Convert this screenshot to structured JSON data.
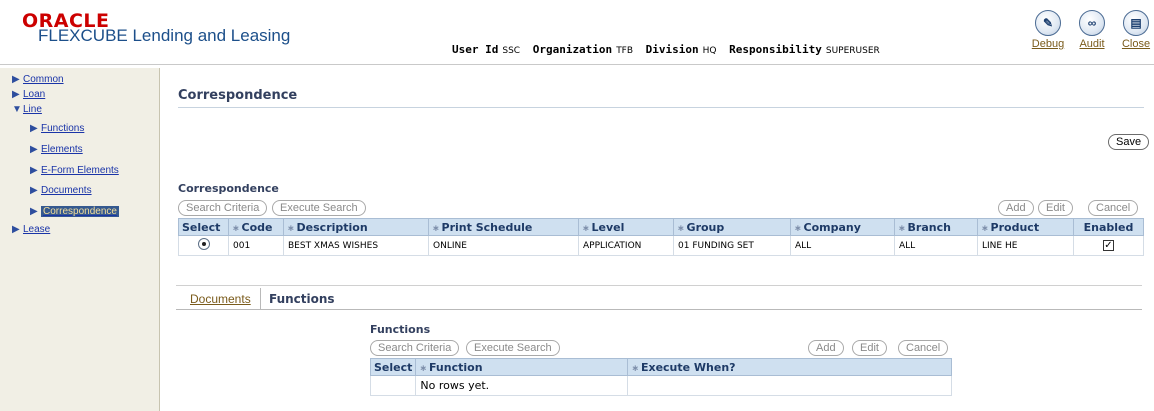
{
  "header": {
    "brand": "ORACLE",
    "app_name": "FLEXCUBE Lending and Leasing",
    "user_fields": [
      {
        "label": "User Id",
        "value": "SSC"
      },
      {
        "label": "Organization",
        "value": "TFB"
      },
      {
        "label": "Division",
        "value": "HQ"
      },
      {
        "label": "Responsibility",
        "value": "SUPERUSER"
      }
    ],
    "global_buttons": [
      {
        "label": "Debug",
        "icon": "debug-icon",
        "glyph": "✎"
      },
      {
        "label": "Audit",
        "icon": "audit-icon",
        "glyph": "∞"
      },
      {
        "label": "Close",
        "icon": "close-icon",
        "glyph": "▤"
      }
    ]
  },
  "sidebar": {
    "items": [
      {
        "label": "Common",
        "expanded": false,
        "level": 0
      },
      {
        "label": "Loan",
        "expanded": false,
        "level": 0
      },
      {
        "label": "Line",
        "expanded": true,
        "level": 0
      },
      {
        "label": "Functions",
        "level": 1
      },
      {
        "label": "Elements",
        "level": 1
      },
      {
        "label": "E-Form Elements",
        "level": 1
      },
      {
        "label": "Documents",
        "level": 1
      },
      {
        "label": "Correspondence",
        "level": 1,
        "selected": true
      },
      {
        "label": "Lease",
        "expanded": false,
        "level": 0
      }
    ]
  },
  "main": {
    "title": "Correspondence",
    "save_label": "Save",
    "section_label": "Correspondence",
    "toolbar": {
      "search_criteria": "Search Criteria",
      "execute_search": "Execute Search",
      "add": "Add",
      "edit": "Edit",
      "cancel": "Cancel"
    },
    "columns": [
      "Select",
      "Code",
      "Description",
      "Print Schedule",
      "Level",
      "Group",
      "Company",
      "Branch",
      "Product",
      "Enabled"
    ],
    "rows": [
      {
        "code": "001",
        "description": "BEST XMAS WISHES",
        "print_schedule": "ONLINE",
        "level": "APPLICATION",
        "group": "01 FUNDING SET",
        "company": "ALL",
        "branch": "ALL",
        "product": "LINE HE",
        "enabled": true,
        "selected": true
      }
    ],
    "tabs": {
      "documents": "Documents",
      "functions": "Functions"
    },
    "functions": {
      "section_label": "Functions",
      "toolbar": {
        "search_criteria": "Search Criteria",
        "execute_search": "Execute Search",
        "add": "Add",
        "edit": "Edit",
        "cancel": "Cancel"
      },
      "columns": [
        "Select",
        "Function",
        "Execute When?"
      ],
      "empty_text": "No rows yet."
    }
  }
}
